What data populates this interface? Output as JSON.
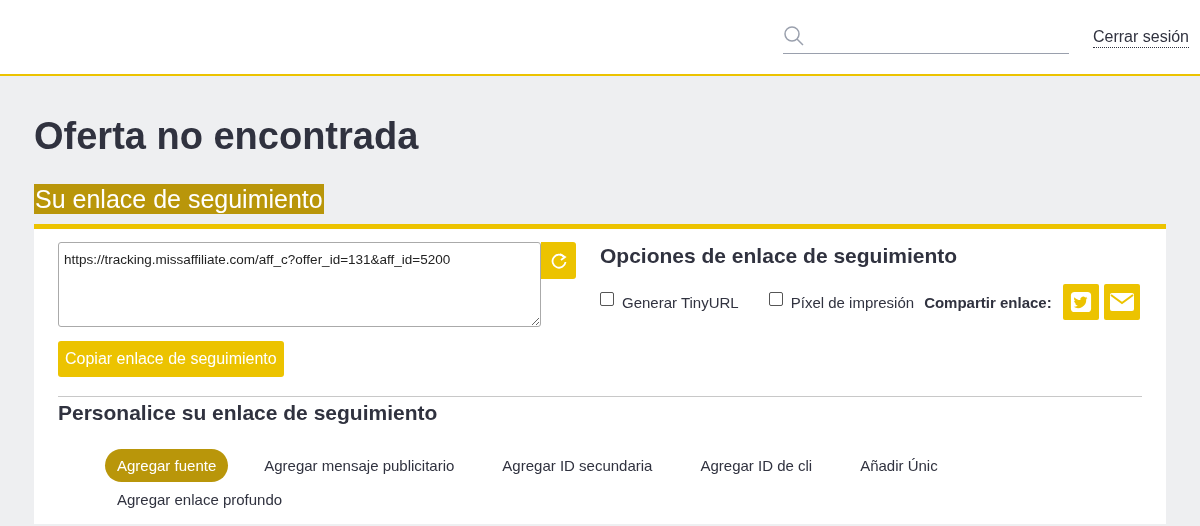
{
  "header": {
    "logout": "Cerrar sesión"
  },
  "title": "Oferta no encontrada",
  "section_title": "Su enlace de seguimiento",
  "tracking_link": {
    "value": "https://tracking.missaffiliate.com/aff_c?offer_id=131&aff_id=5200",
    "copy_button": "Copiar enlace de seguimiento"
  },
  "options": {
    "title": "Opciones de enlace de seguimiento",
    "checkboxes": [
      {
        "label": "Generar TinyURL",
        "checked": false
      },
      {
        "label": "Píxel de impresión",
        "checked": false
      }
    ],
    "share_label": "Compartir enlace:"
  },
  "customize": {
    "title": "Personalice su enlace de seguimiento",
    "tabs": [
      {
        "label": "Agregar fuente",
        "selected": true
      },
      {
        "label": "Agregar mensaje publicitario",
        "selected": false
      },
      {
        "label": "Agregar ID secundaria",
        "selected": false
      },
      {
        "label": "Agregar ID de cli",
        "selected": false
      },
      {
        "label": "Añadir Únic",
        "selected": false
      },
      {
        "label": "Agregar enlace profundo",
        "selected": false
      }
    ]
  }
}
